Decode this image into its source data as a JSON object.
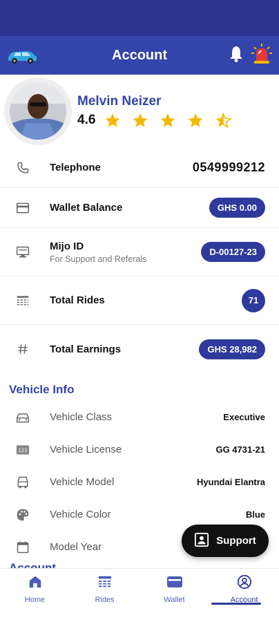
{
  "header": {
    "title": "Account",
    "left_icon": "car-icon",
    "right_icons": [
      "bell-icon",
      "siren-icon"
    ]
  },
  "profile": {
    "name": "Melvin Neizer",
    "rating": "4.6",
    "stars": 4.5
  },
  "info_rows": {
    "telephone": {
      "label": "Telephone",
      "value": "0549999212",
      "icon": "phone-icon"
    },
    "wallet": {
      "label": "Wallet Balance",
      "value": "GHS 0.00",
      "icon": "card-icon"
    },
    "mijo": {
      "label": "Mijo ID",
      "sub": "For Support and Referals",
      "value": "D-00127-23",
      "icon": "id-monitor-icon"
    },
    "rides": {
      "label": "Total Rides",
      "value": "71",
      "icon": "list-icon"
    },
    "earnings": {
      "label": "Total Earnings",
      "value": "GHS 28,982",
      "icon": "hash-icon"
    }
  },
  "vehicle": {
    "section_title": "Vehicle Info",
    "rows": [
      {
        "label": "Vehicle Class",
        "value": "Executive",
        "icon": "car-front-icon"
      },
      {
        "label": "Vehicle License",
        "value": "GG 4731-21",
        "icon": "license-plate-icon"
      },
      {
        "label": "Vehicle Model",
        "value": "Hyundai Elantra",
        "icon": "car-model-icon"
      },
      {
        "label": "Vehicle Color",
        "value": "Blue",
        "icon": "palette-icon"
      },
      {
        "label": "Model Year",
        "value": "",
        "icon": "calendar-icon"
      }
    ]
  },
  "next_section_title": "Account",
  "support": {
    "label": "Support",
    "icon": "support-icon"
  },
  "nav": {
    "items": [
      {
        "label": "Home",
        "icon": "home-icon"
      },
      {
        "label": "Rides",
        "icon": "rides-icon"
      },
      {
        "label": "Wallet",
        "icon": "wallet-icon"
      },
      {
        "label": "Account",
        "icon": "account-icon"
      }
    ],
    "active": "Account"
  },
  "colors": {
    "primary": "#3344aa",
    "status_bar": "#2a3390",
    "pill": "#2e3b9c",
    "star": "#f5b800"
  }
}
